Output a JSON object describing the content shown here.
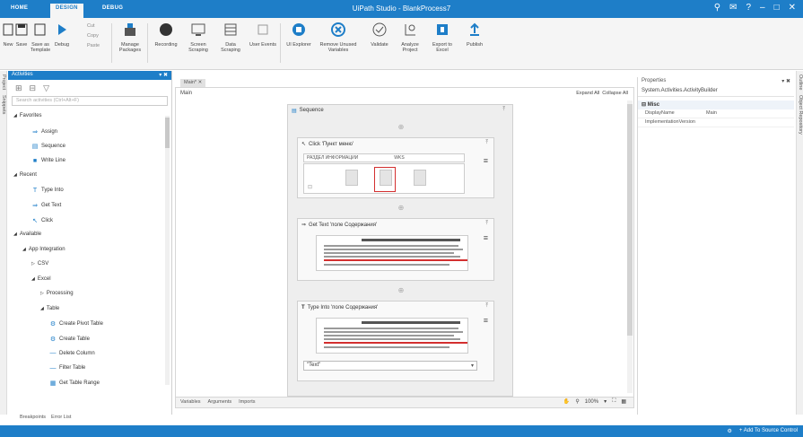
{
  "titlebar": {
    "tabs": [
      "HOME",
      "DESIGN",
      "DEBUG"
    ],
    "title": "UiPath Studio - BlankProcess7"
  },
  "ribbon": {
    "buttons": [
      {
        "label": "New",
        "icon": "new-file-icon"
      },
      {
        "label": "Save",
        "icon": "save-icon"
      },
      {
        "label": "Save as Template",
        "icon": "save-template-icon"
      },
      {
        "label": "Debug",
        "icon": "debug-play-icon"
      },
      {
        "label": "Manage Packages",
        "icon": "packages-icon"
      },
      {
        "label": "Recording",
        "icon": "recording-icon"
      },
      {
        "label": "Screen Scraping",
        "icon": "screen-scraping-icon"
      },
      {
        "label": "Data Scraping",
        "icon": "data-scraping-icon"
      },
      {
        "label": "User Events",
        "icon": "user-events-icon"
      },
      {
        "label": "UI Explorer",
        "icon": "ui-explorer-icon"
      },
      {
        "label": "Remove Unused Variables",
        "icon": "remove-variables-icon"
      },
      {
        "label": "Validate",
        "icon": "validate-icon"
      },
      {
        "label": "Analyze Project",
        "icon": "analyze-icon"
      },
      {
        "label": "Export to Excel",
        "icon": "excel-icon"
      },
      {
        "label": "Publish",
        "icon": "publish-icon"
      }
    ],
    "small": [
      "Cut",
      "Copy",
      "Paste"
    ]
  },
  "side_tabs_left": [
    "Project",
    "Snippets"
  ],
  "side_tabs_right": [
    "Outline",
    "Object Repository"
  ],
  "activities": {
    "title": "Activities",
    "search_placeholder": "Search activities (Ctrl+Alt+F)",
    "tree": [
      {
        "label": "Favorites",
        "indent": 0,
        "kind": "group"
      },
      {
        "label": "Assign",
        "indent": 2,
        "icon": "⇒"
      },
      {
        "label": "Sequence",
        "indent": 2,
        "icon": "▤"
      },
      {
        "label": "Write Line",
        "indent": 2,
        "icon": "■"
      },
      {
        "label": "Recent",
        "indent": 0,
        "kind": "group"
      },
      {
        "label": "Type Into",
        "indent": 2,
        "icon": "T"
      },
      {
        "label": "Get Text",
        "indent": 2,
        "icon": "⇒"
      },
      {
        "label": "Click",
        "indent": 2,
        "icon": "↖"
      },
      {
        "label": "Available",
        "indent": 0,
        "kind": "group"
      },
      {
        "label": "App Integration",
        "indent": 1,
        "kind": "group"
      },
      {
        "label": "CSV",
        "indent": 2,
        "kind": "closed"
      },
      {
        "label": "Excel",
        "indent": 2,
        "kind": "group"
      },
      {
        "label": "Processing",
        "indent": 3,
        "kind": "closed"
      },
      {
        "label": "Table",
        "indent": 3,
        "kind": "group"
      },
      {
        "label": "Create Pivot Table",
        "indent": 4,
        "icon": "⚙"
      },
      {
        "label": "Create Table",
        "indent": 4,
        "icon": "⚙"
      },
      {
        "label": "Delete Column",
        "indent": 4,
        "icon": "—"
      },
      {
        "label": "Filter Table",
        "indent": 4,
        "icon": "—"
      },
      {
        "label": "Get Table Range",
        "indent": 4,
        "icon": "▦"
      }
    ]
  },
  "bottom_tabs": [
    "Breakpoints",
    "Error List"
  ],
  "designer": {
    "tab": "Main*",
    "breadcrumb": "Main",
    "expand_all": "Expand All",
    "collapse_all": "Collapse All",
    "sequence_title": "Sequence",
    "activities": [
      {
        "title": "Click 'Пункт меню'",
        "selector_left": "РАЗДЕЛ ИНФОРМАЦИИ",
        "selector_right": "WKS"
      },
      {
        "title": "Get Text 'поле Содержания'"
      },
      {
        "title": "Type Into 'поле Содержания'",
        "input_value": "\"Text\""
      }
    ],
    "bottom_tabs": [
      "Variables",
      "Arguments",
      "Imports"
    ],
    "zoom": "100%"
  },
  "properties": {
    "title": "Properties",
    "type": "System.Activities.ActivityBuilder",
    "category": "Misc",
    "rows": [
      {
        "key": "DisplayName",
        "value": "Main"
      },
      {
        "key": "ImplementationVersion",
        "value": ""
      }
    ]
  },
  "status": {
    "source_control": "+ Add To Source Control"
  },
  "colors": {
    "accent": "#1e7ec8",
    "highlight_red": "#d32f2f"
  }
}
